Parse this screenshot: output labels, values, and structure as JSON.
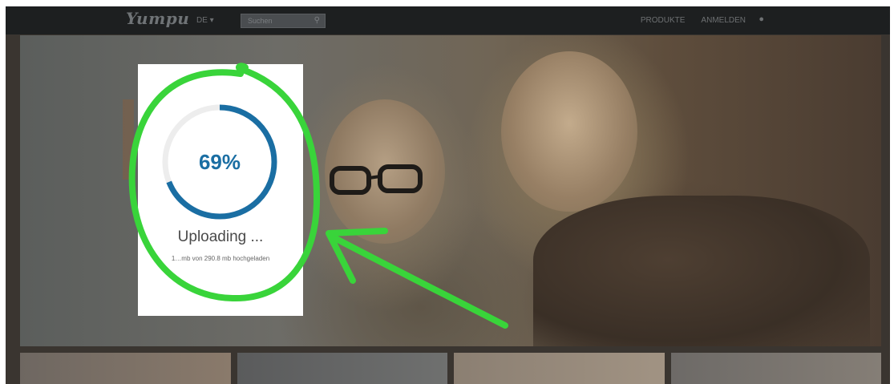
{
  "navbar": {
    "logo": "Yumpu",
    "language": "DE ▾",
    "search_placeholder": "Suchen",
    "links": [
      "PRODUKTE",
      "ANMELDEN"
    ]
  },
  "upload": {
    "percent_label": "69%",
    "progress_fraction": 0.69,
    "status": "Uploading ...",
    "detail": "1…mb von 290.8 mb hochgeladen"
  },
  "colors": {
    "accent": "#1a6ea3",
    "ring_track": "#ededed",
    "annotation": "#39d43a",
    "navbar": "#1d1f20"
  },
  "icons": {
    "search": "search-icon",
    "user": "user-icon"
  }
}
